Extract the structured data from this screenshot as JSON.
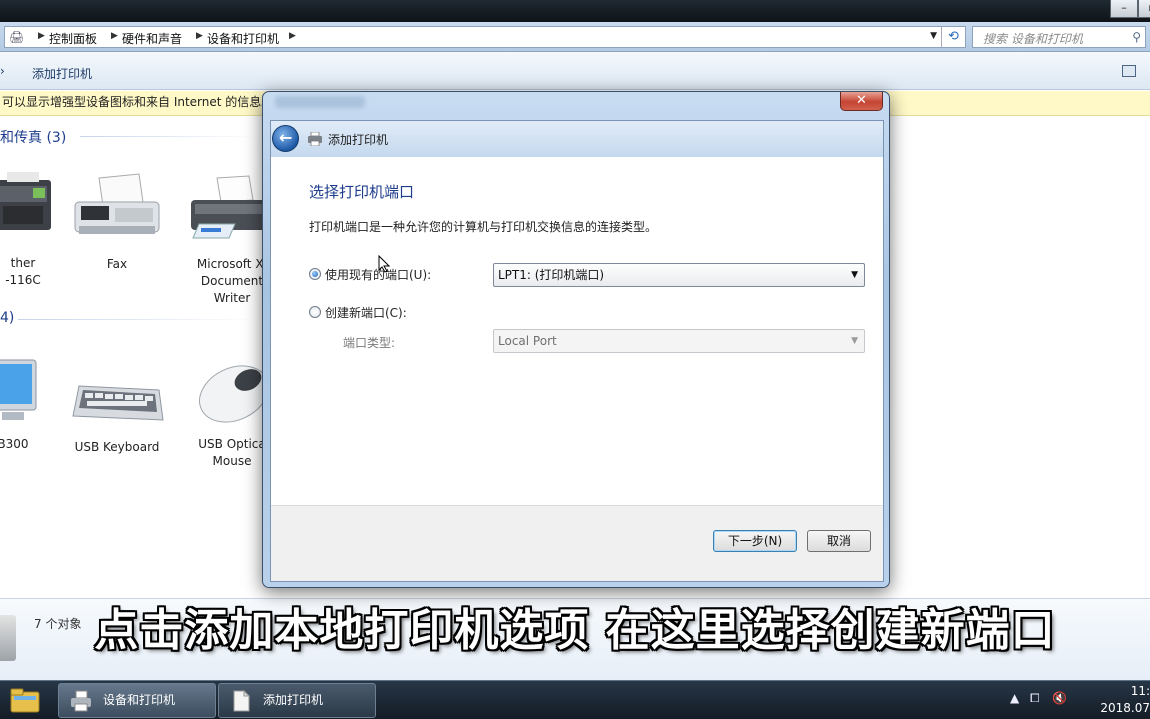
{
  "explorer": {
    "breadcrumbs": [
      "控制面板",
      "硬件和声音",
      "设备和打印机"
    ],
    "search_placeholder": "搜索 设备和打印机",
    "toolbar": {
      "add_printer": "添加打印机"
    },
    "infobar_text": "可以显示增强型设备图标和来自 Internet 的信息。",
    "groups": [
      {
        "heading": "和传真 (3)"
      },
      {
        "heading": "4)"
      }
    ],
    "printers": [
      {
        "label_lines": [
          "ther",
          "-116C"
        ],
        "icon": "multifunction-printer-icon"
      },
      {
        "label_lines": [
          "Fax"
        ],
        "icon": "fax-icon"
      },
      {
        "label_lines": [
          "Microsoft XI",
          "Document",
          "Writer"
        ],
        "icon": "printer-icon"
      }
    ],
    "devices": [
      {
        "label_lines": [
          "B300"
        ],
        "icon": "monitor-icon"
      },
      {
        "label_lines": [
          "USB Keyboard"
        ],
        "icon": "keyboard-icon"
      },
      {
        "label_lines": [
          "USB Optica",
          "Mouse"
        ],
        "icon": "mouse-icon"
      }
    ],
    "status_count": "7 个对象"
  },
  "dialog": {
    "nav_title": "添加打印机",
    "heading": "选择打印机端口",
    "description": "打印机端口是一种允许您的计算机与打印机交换信息的连接类型。",
    "use_existing": {
      "label": "使用现有的端口(U):",
      "selected": true,
      "value": "LPT1: (打印机端口)"
    },
    "create_new": {
      "label": "创建新端口(C):",
      "selected": false
    },
    "port_type": {
      "label": "端口类型:",
      "value": "Local Port",
      "enabled": false
    },
    "buttons": {
      "next": "下一步(N)",
      "cancel": "取消"
    },
    "close_glyph": "✕"
  },
  "taskbar": {
    "tasks": [
      {
        "label": "设备和打印机",
        "active": true
      },
      {
        "label": "添加打印机",
        "active": false
      }
    ],
    "clock_time": "11:",
    "clock_date": "2018.07"
  },
  "subtitle": "点击添加本地打印机选项 在这里选择创建新端口",
  "colors": {
    "heading_blue": "#1e3d8c",
    "infobar_bg": "#fff9c7",
    "close_red": "#c54532"
  }
}
